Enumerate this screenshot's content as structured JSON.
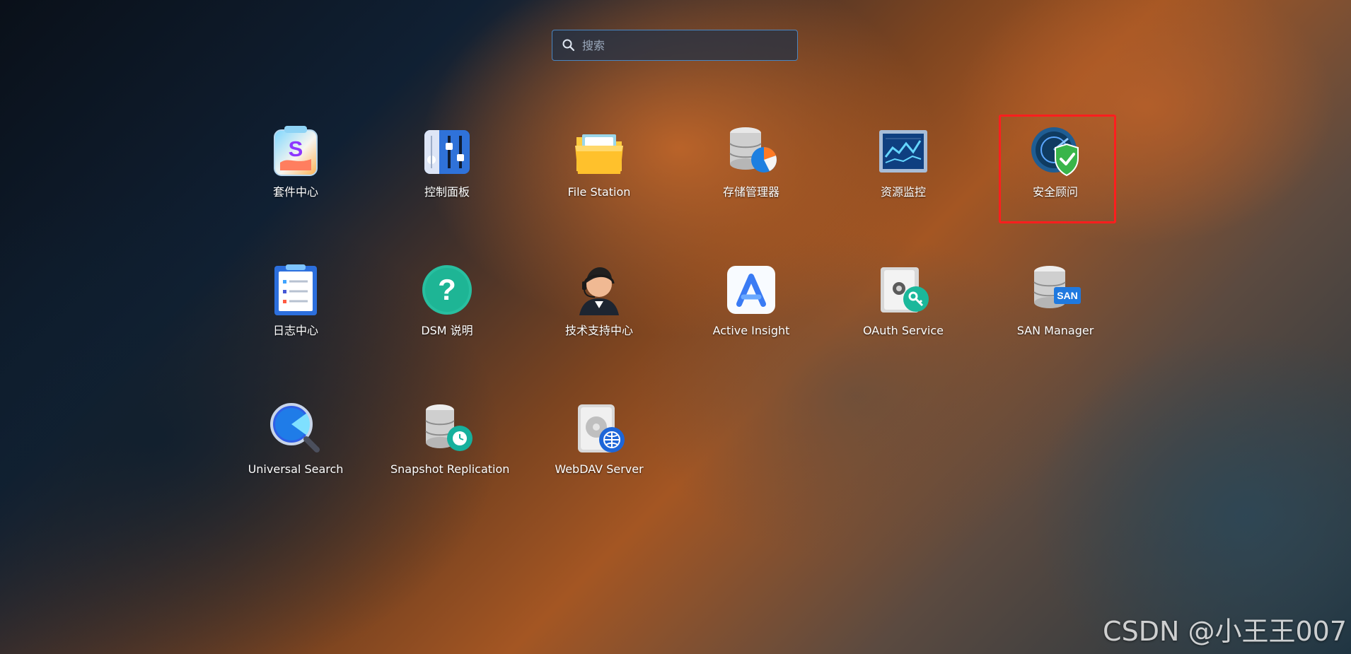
{
  "search": {
    "placeholder": "搜索"
  },
  "apps": {
    "package_center": "套件中心",
    "control_panel": "控制面板",
    "file_station": "File Station",
    "storage_manager": "存储管理器",
    "resource_monitor": "资源监控",
    "security_advisor": "安全顾问",
    "log_center": "日志中心",
    "dsm_help": "DSM 说明",
    "support_center": "技术支持中心",
    "active_insight": "Active Insight",
    "oauth_service": "OAuth Service",
    "san_manager": "SAN Manager",
    "universal_search": "Universal Search",
    "snapshot_replication": "Snapshot Replication",
    "webdav_server": "WebDAV Server"
  },
  "icon_text": {
    "san_badge": "SAN"
  },
  "watermark": "CSDN @小王王007",
  "colors": {
    "selection_outline": "#ff1e1e",
    "search_border": "#4b86c0"
  }
}
